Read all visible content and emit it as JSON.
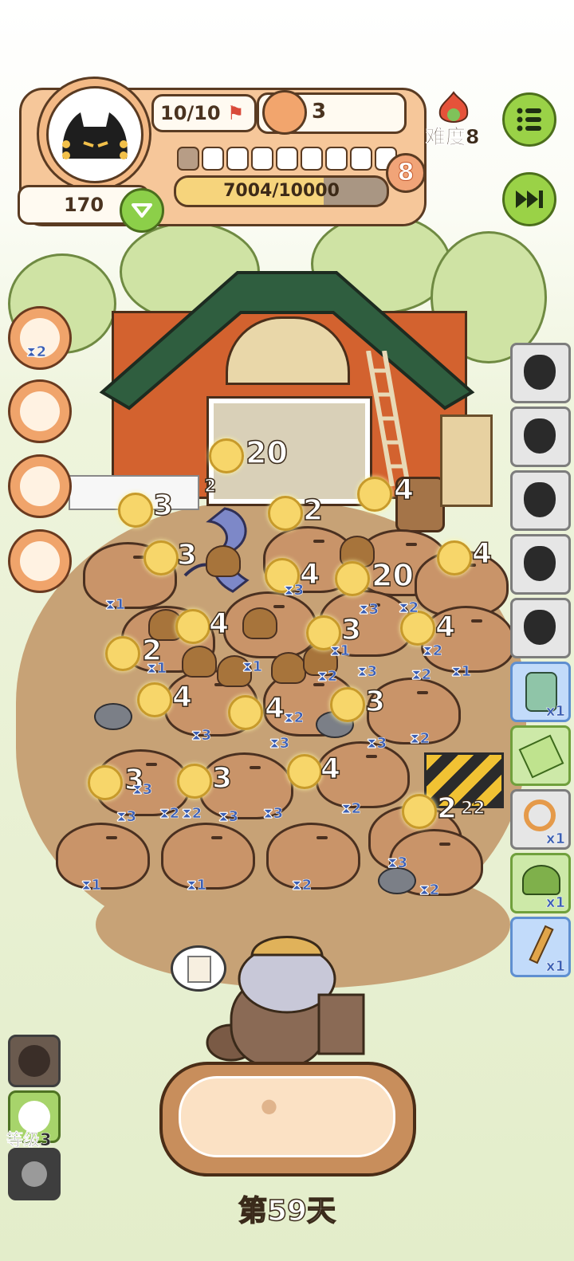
{
  "hud": {
    "lives": "10/10",
    "food_count": "3",
    "coins": "170",
    "level": "8",
    "xp_text": "7004/10000",
    "xp_fraction": 0.7004,
    "segments_total": 9,
    "segments_filled": 1,
    "difficulty": "难度8"
  },
  "scene": {
    "labels": [
      "20",
      "3",
      "2",
      "2",
      "4",
      "3",
      "4",
      "20",
      "4",
      "4",
      "3",
      "4",
      "2",
      "4",
      "4",
      "3",
      "3",
      "3",
      "4",
      "2",
      "22"
    ],
    "hourglass": [
      "1",
      "1",
      "3",
      "2",
      "1",
      "1",
      "2",
      "3",
      "2",
      "3",
      "2",
      "1",
      "3",
      "2",
      "3",
      "3",
      "2",
      "3",
      "3",
      "2",
      "3",
      "3",
      "2",
      "1",
      "1",
      "2",
      "3",
      "2",
      "2",
      "2",
      "2"
    ]
  },
  "side_left": {
    "top_badge": "2"
  },
  "side_right": [
    {
      "icon": "trash-bag-icon",
      "count": ""
    },
    {
      "icon": "trash-bag-icon",
      "count": ""
    },
    {
      "icon": "trash-bag-icon",
      "count": ""
    },
    {
      "icon": "trash-bag-icon",
      "count": ""
    },
    {
      "icon": "trash-bag-icon",
      "count": ""
    },
    {
      "icon": "jar-icon",
      "count": "x1"
    },
    {
      "icon": "ticket-icon",
      "count": ""
    },
    {
      "icon": "worm-icon",
      "count": "x1"
    },
    {
      "icon": "tent-icon",
      "count": "x1"
    },
    {
      "icon": "shovel-icon",
      "count": "x1"
    }
  ],
  "bottom": {
    "level_label": "等级3",
    "day": "第59天"
  }
}
